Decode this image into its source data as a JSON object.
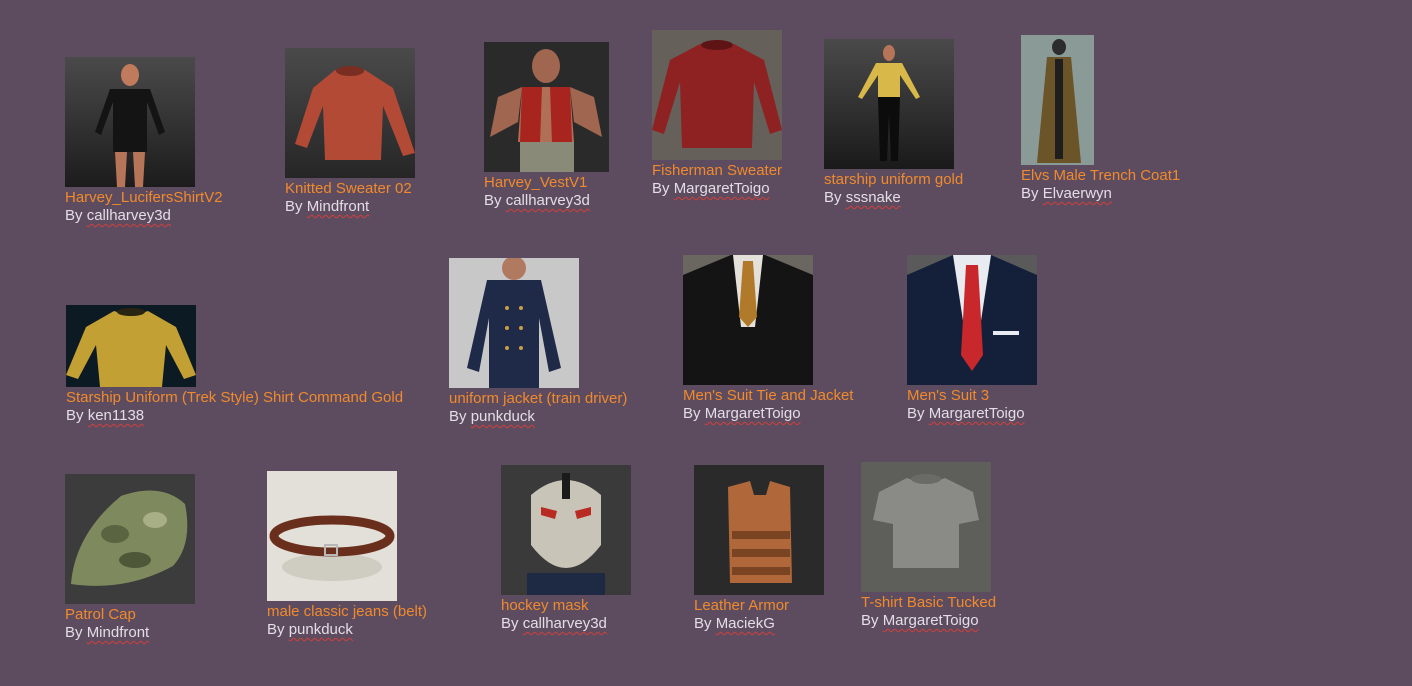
{
  "by_label": "By",
  "items": [
    {
      "title": "Harvey_LucifersShirtV2",
      "author": "callharvey3d"
    },
    {
      "title": "Knitted Sweater 02",
      "author": "Mindfront"
    },
    {
      "title": "Harvey_VestV1",
      "author": "callharvey3d"
    },
    {
      "title": "Fisherman Sweater",
      "author": "MargaretToigo"
    },
    {
      "title": "starship uniform gold",
      "author": "sssnake"
    },
    {
      "title": "Elvs Male Trench Coat1",
      "author": "Elvaerwyn"
    },
    {
      "title": "Starship Uniform (Trek Style) Shirt Command Gold",
      "author": "ken1138"
    },
    {
      "title": "uniform jacket (train driver)",
      "author": "punkduck"
    },
    {
      "title": "Men's Suit Tie and Jacket",
      "author": "MargaretToigo"
    },
    {
      "title": "Men's Suit 3",
      "author": "MargaretToigo"
    },
    {
      "title": "Patrol Cap",
      "author": "Mindfront"
    },
    {
      "title": "male classic jeans (belt)",
      "author": "punkduck"
    },
    {
      "title": "hockey mask",
      "author": "callharvey3d"
    },
    {
      "title": "Leather Armor",
      "author": "MaciekG"
    },
    {
      "title": "T-shirt Basic Tucked",
      "author": "MargaretToigo"
    }
  ]
}
